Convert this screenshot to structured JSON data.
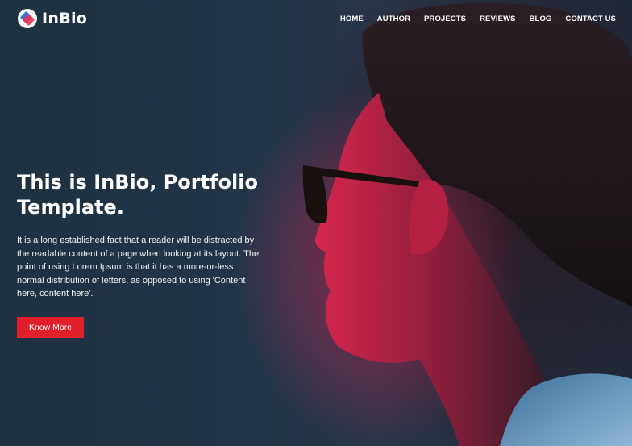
{
  "brand": {
    "name": "InBio"
  },
  "nav": {
    "items": [
      {
        "label": "HOME"
      },
      {
        "label": "AUTHOR"
      },
      {
        "label": "PROJECTS"
      },
      {
        "label": "REVIEWS"
      },
      {
        "label": "BLOG"
      },
      {
        "label": "CONTACT US"
      }
    ]
  },
  "hero": {
    "headline": "This is InBio, Portfolio Template.",
    "description": "It is a long established fact that a reader will be distracted by the readable content of a page when looking at its layout. The point of using Lorem Ipsum is that it has a more-or-less normal distribution of letters, as opposed to using 'Content here, content here'.",
    "cta_label": "Know More"
  },
  "colors": {
    "accent": "#e01f2a",
    "background": "#1c2d3d",
    "text": "#ffffff"
  },
  "icons": {
    "logo": "logo-icon"
  }
}
